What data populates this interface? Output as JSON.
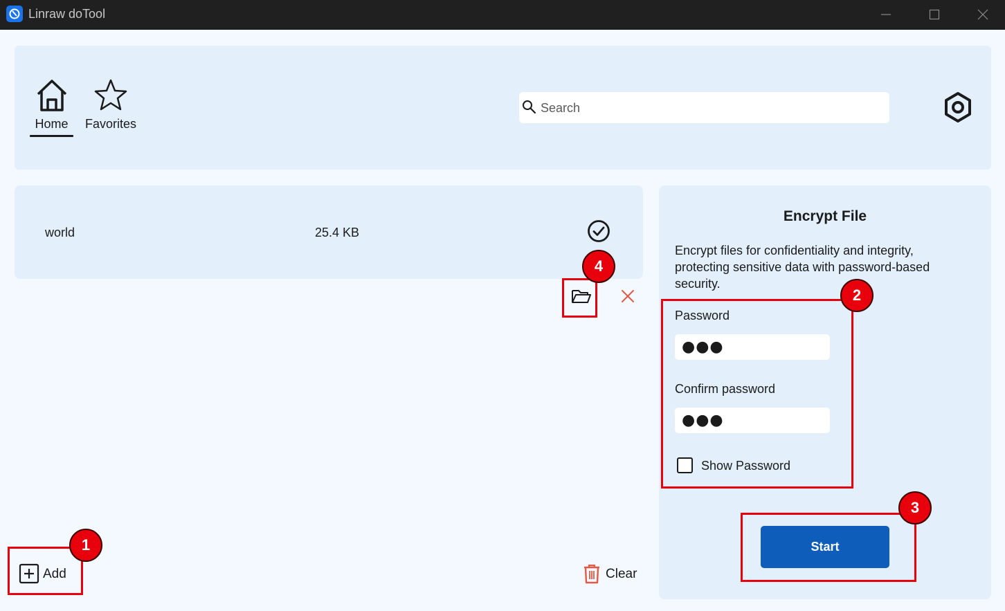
{
  "window": {
    "title": "Linraw doTool"
  },
  "nav": {
    "home_label": "Home",
    "favorites_label": "Favorites",
    "active": "Home"
  },
  "search": {
    "placeholder": "Search",
    "value": ""
  },
  "files": [
    {
      "name": "world",
      "size": "25.4 KB",
      "status": "completed"
    }
  ],
  "file_list_actions": {
    "add_label": "Add",
    "clear_label": "Clear"
  },
  "encrypt": {
    "title": "Encrypt File",
    "description": "Encrypt files for confidentiality and integrity, protecting sensitive data with password-based security.",
    "password_label": "Password",
    "password_value": "●●●",
    "confirm_label": "Confirm password",
    "confirm_value": "●●●",
    "show_password_label": "Show Password",
    "show_password_checked": false,
    "start_label": "Start"
  },
  "annotations": [
    {
      "number": "1",
      "target": "Add"
    },
    {
      "number": "2",
      "target": "Password fields"
    },
    {
      "number": "3",
      "target": "Start"
    },
    {
      "number": "4",
      "target": "Open folder"
    }
  ],
  "colors": {
    "accent": "#0f5dbb",
    "panel": "#e3f0fb",
    "background": "#f3f9fe",
    "titlebar": "#202020",
    "annotation": "#e8000d",
    "danger_icon": "#e05a47"
  }
}
